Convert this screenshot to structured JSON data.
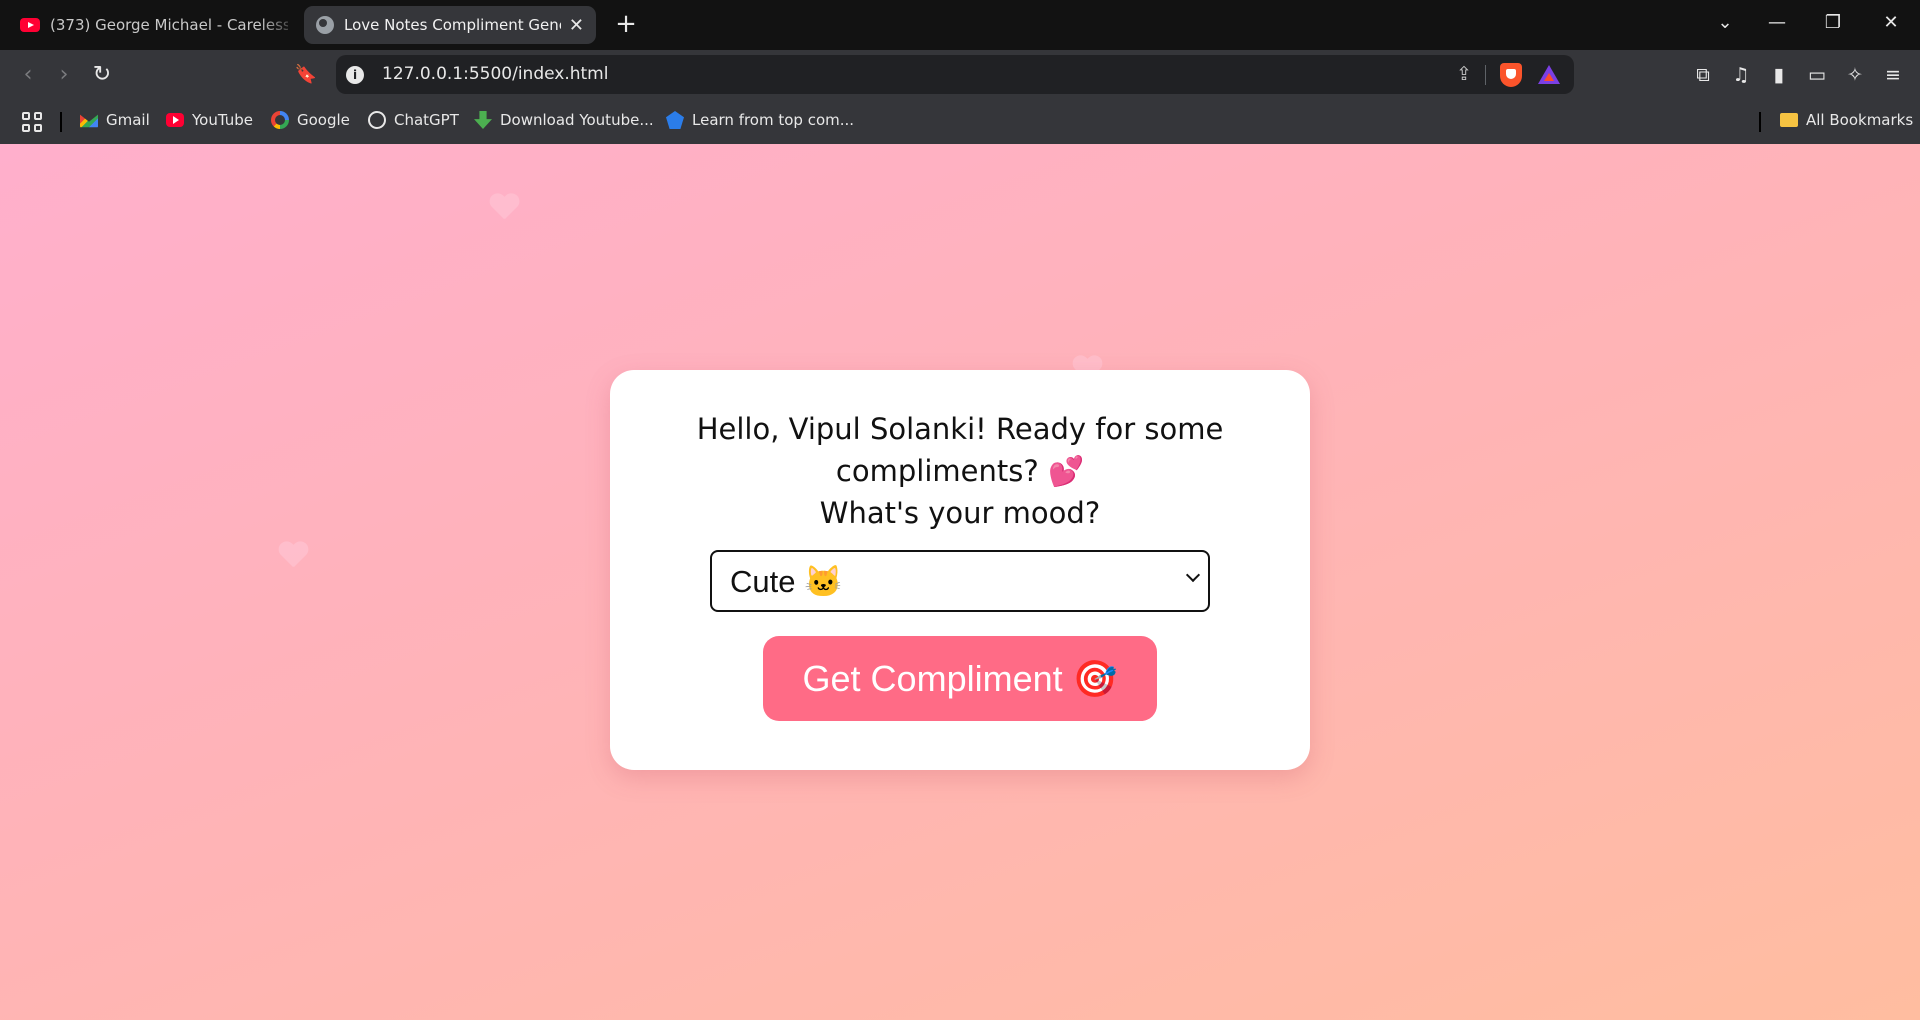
{
  "browser": {
    "tabs": [
      {
        "title": "(373) George Michael - Careless Whisper",
        "favicon": "youtube-icon",
        "active": false
      },
      {
        "title": "Love Notes Compliment Generator",
        "favicon": "globe-icon",
        "active": true
      }
    ],
    "new_tab_label": "+",
    "address": "127.0.0.1:5500/index.html",
    "bookmarks": [
      {
        "label": "Gmail",
        "icon": "gmail-icon"
      },
      {
        "label": "YouTube",
        "icon": "youtube-icon"
      },
      {
        "label": "Google",
        "icon": "google-icon"
      },
      {
        "label": "ChatGPT",
        "icon": "chatgpt-icon"
      },
      {
        "label": "Download Youtube...",
        "icon": "download-icon"
      },
      {
        "label": "Learn from top com...",
        "icon": "learn-icon"
      }
    ],
    "all_bookmarks_label": "All Bookmarks",
    "glyphs": {
      "close": "✕",
      "chevron_down": "⌄",
      "minimize": "—",
      "restore": "❐",
      "back": "‹",
      "forward": "›",
      "reload": "↻",
      "bookmark": "🔖",
      "info": "i",
      "share": "⇪",
      "extensions": "⧉",
      "music": "♫",
      "sidebar": "▮",
      "wallet": "▭",
      "leo": "✧",
      "menu": "≡"
    }
  },
  "page": {
    "greeting_line1": "Hello, Vipul Solanki! Ready for some compliments? 💕",
    "greeting_line2": "What's your mood?",
    "mood_selected": "Cute 🐱",
    "button_label": "Get Compliment 🎯",
    "colors": {
      "background_start": "#ffafcc",
      "background_end": "#ffbda0",
      "button": "#ff6b86",
      "heart": "#ffc8d8"
    }
  }
}
